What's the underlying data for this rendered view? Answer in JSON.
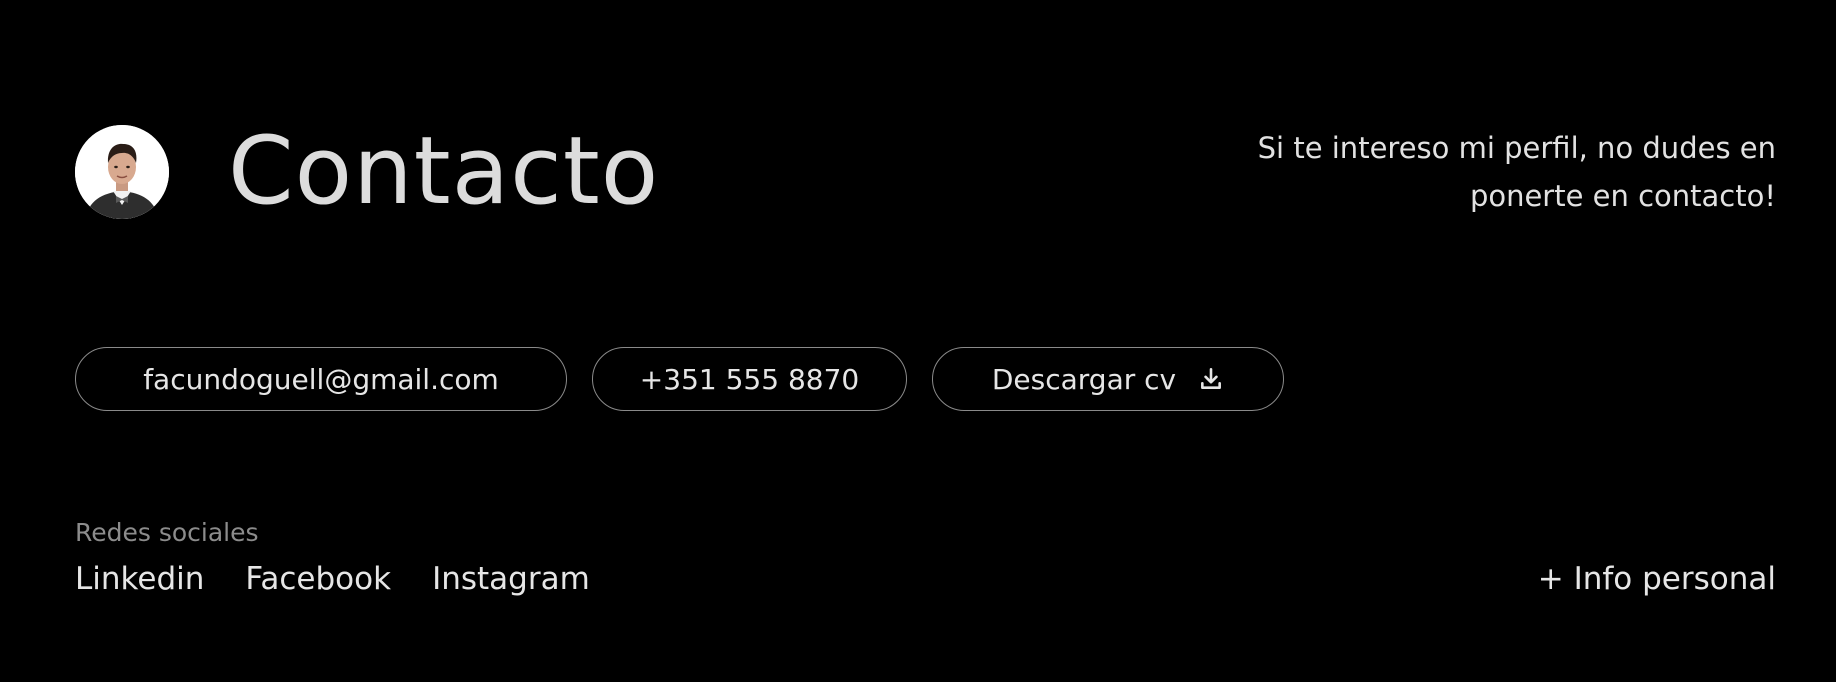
{
  "header": {
    "title": "Contacto",
    "intro_line1": "Si te intereso mi perfil, no dudes en",
    "intro_line2": "ponerte en contacto!"
  },
  "contact": {
    "email": "facundoguell@gmail.com",
    "phone": "+351 555 8870",
    "cv_label": "Descargar cv",
    "cv_icon": "download-icon"
  },
  "social": {
    "heading": "Redes sociales",
    "links": [
      "Linkedin",
      "Facebook",
      "Instagram"
    ]
  },
  "footer": {
    "info_link": "+ Info personal"
  },
  "colors": {
    "background": "#000000",
    "text": "#e6e6e6",
    "muted": "#8c8c8c",
    "border": "#8a8a8a"
  }
}
